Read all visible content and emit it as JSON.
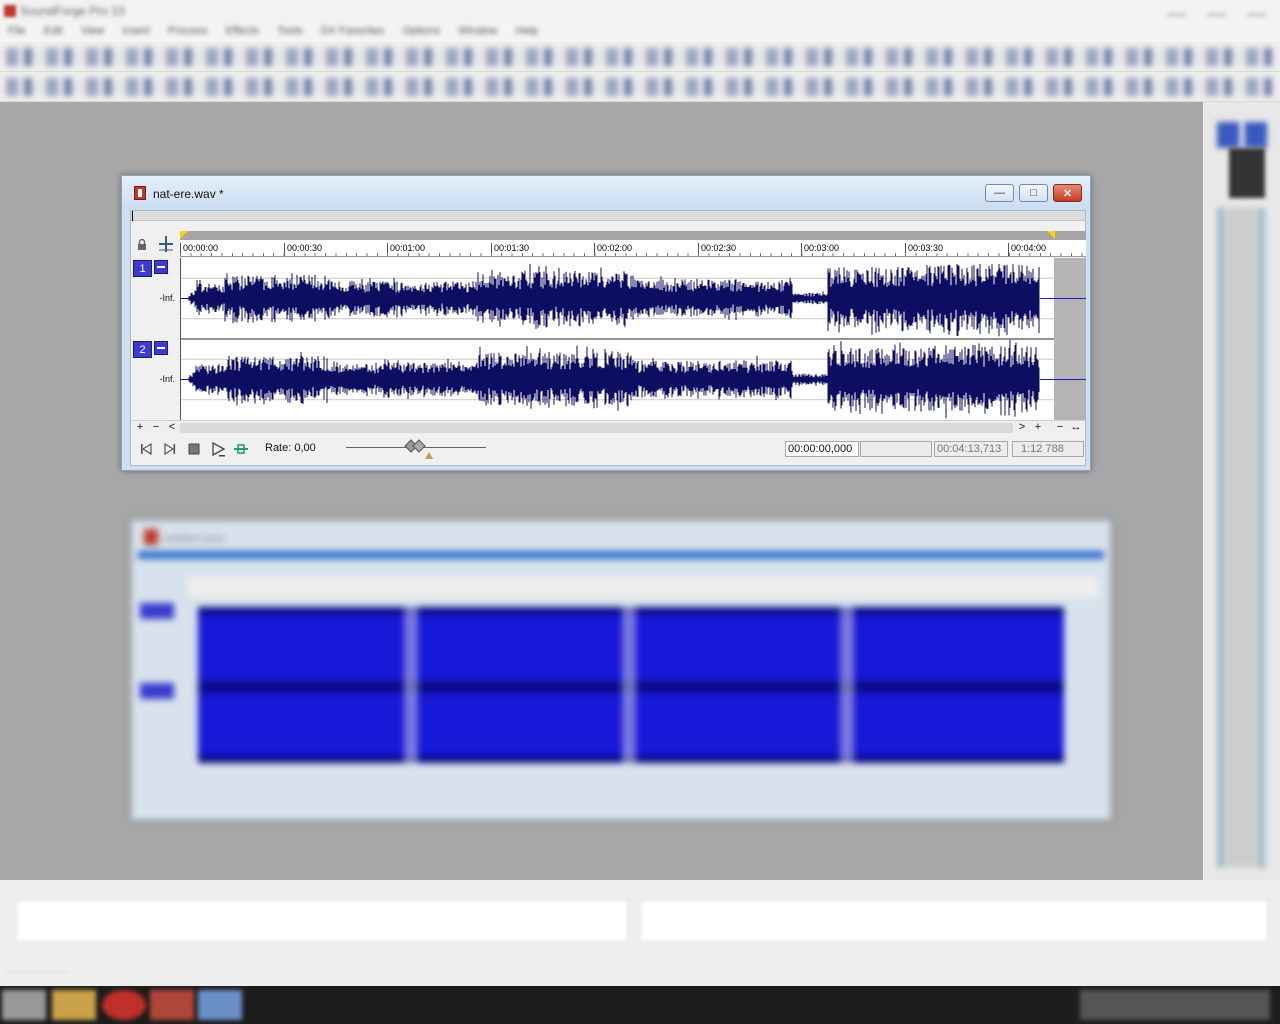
{
  "app": {
    "title": "SoundForge Pro 10",
    "menu": [
      "File",
      "Edit",
      "View",
      "Insert",
      "Process",
      "Effects",
      "Tools",
      "DX Favorites",
      "Options",
      "Window",
      "Help"
    ]
  },
  "wav_window": {
    "title": "nat-ere.wav *",
    "buttons": {
      "minimize": "—",
      "restore": "□",
      "close": "✕"
    },
    "ruler_ticks": [
      "00:00:00",
      "00:00:30",
      "00:01:00",
      "00:01:30",
      "00:02:00",
      "00:02:30",
      "00:03:00",
      "00:03:30",
      "00:04:00"
    ],
    "channels": [
      {
        "number": "1",
        "level_label": "-Inf."
      },
      {
        "number": "2",
        "level_label": "-Inf."
      }
    ],
    "scrollbar": {
      "zoom_in": "+",
      "zoom_out": "−",
      "left": "<",
      "right": ">",
      "zoom_in_r": "+",
      "zoom_out_r": "−",
      "fit": "↔"
    },
    "transport": {
      "rate_label": "Rate: 0,00",
      "cursor_position": "00:00:00,000",
      "selection": "",
      "length": "00:04:13,713",
      "zoom_ratio": "1:12 788"
    },
    "waveform_color": "#0d0d62"
  },
  "second_window": {
    "title": "untitled.wav"
  }
}
